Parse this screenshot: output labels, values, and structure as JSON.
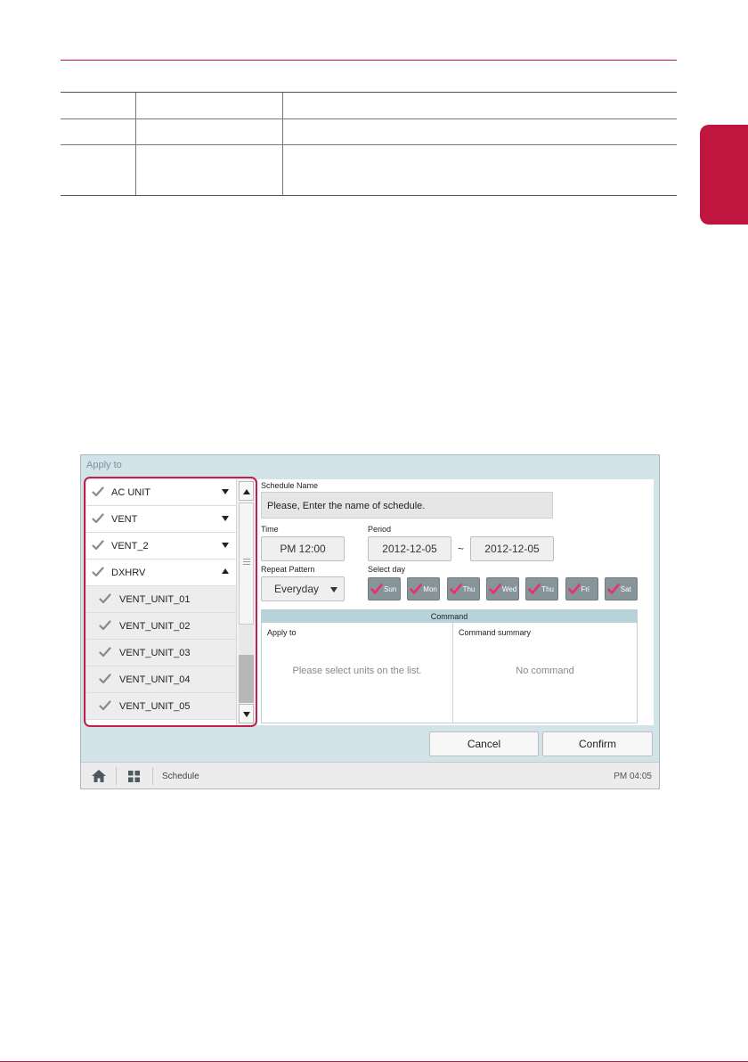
{
  "doc_table": {
    "rows": [
      [
        "",
        "",
        ""
      ],
      [
        "",
        "",
        ""
      ],
      [
        "",
        "",
        ""
      ]
    ]
  },
  "app": {
    "title": "Apply to",
    "units": [
      {
        "label": "AC UNIT",
        "arrow": "down",
        "sub": false
      },
      {
        "label": "VENT",
        "arrow": "down",
        "sub": false
      },
      {
        "label": "VENT_2",
        "arrow": "down",
        "sub": false
      },
      {
        "label": "DXHRV",
        "arrow": "up",
        "sub": false
      },
      {
        "label": "VENT_UNIT_01",
        "arrow": "",
        "sub": true
      },
      {
        "label": "VENT_UNIT_02",
        "arrow": "",
        "sub": true
      },
      {
        "label": "VENT_UNIT_03",
        "arrow": "",
        "sub": true
      },
      {
        "label": "VENT_UNIT_04",
        "arrow": "",
        "sub": true
      },
      {
        "label": "VENT_UNIT_05",
        "arrow": "",
        "sub": true
      }
    ],
    "form": {
      "schedule_name_label": "Schedule Name",
      "schedule_name_placeholder": "Please, Enter the name of schedule.",
      "time_label": "Time",
      "time_value": "PM 12:00",
      "period_label": "Period",
      "period_start": "2012-12-05",
      "period_sep": "~",
      "period_end": "2012-12-05",
      "repeat_label": "Repeat Pattern",
      "repeat_value": "Everyday",
      "select_day_label": "Select day",
      "days": [
        "Sun",
        "Mon",
        "Thu",
        "Wed",
        "Thu",
        "Fri",
        "Sat"
      ]
    },
    "command": {
      "header": "Command",
      "apply_to_title": "Apply to",
      "apply_to_message": "Please select units on the list.",
      "summary_title": "Command summary",
      "summary_message": "No command"
    },
    "buttons": {
      "cancel": "Cancel",
      "confirm": "Confirm"
    },
    "statusbar": {
      "breadcrumb": "Schedule",
      "time": "PM 04:05"
    }
  },
  "colors": {
    "accent": "#c0153f",
    "panel_bg": "#d2e4ea",
    "day_chip": "#87959b",
    "check_pink": "#e8306a",
    "check_gray": "#8a8a8a"
  }
}
